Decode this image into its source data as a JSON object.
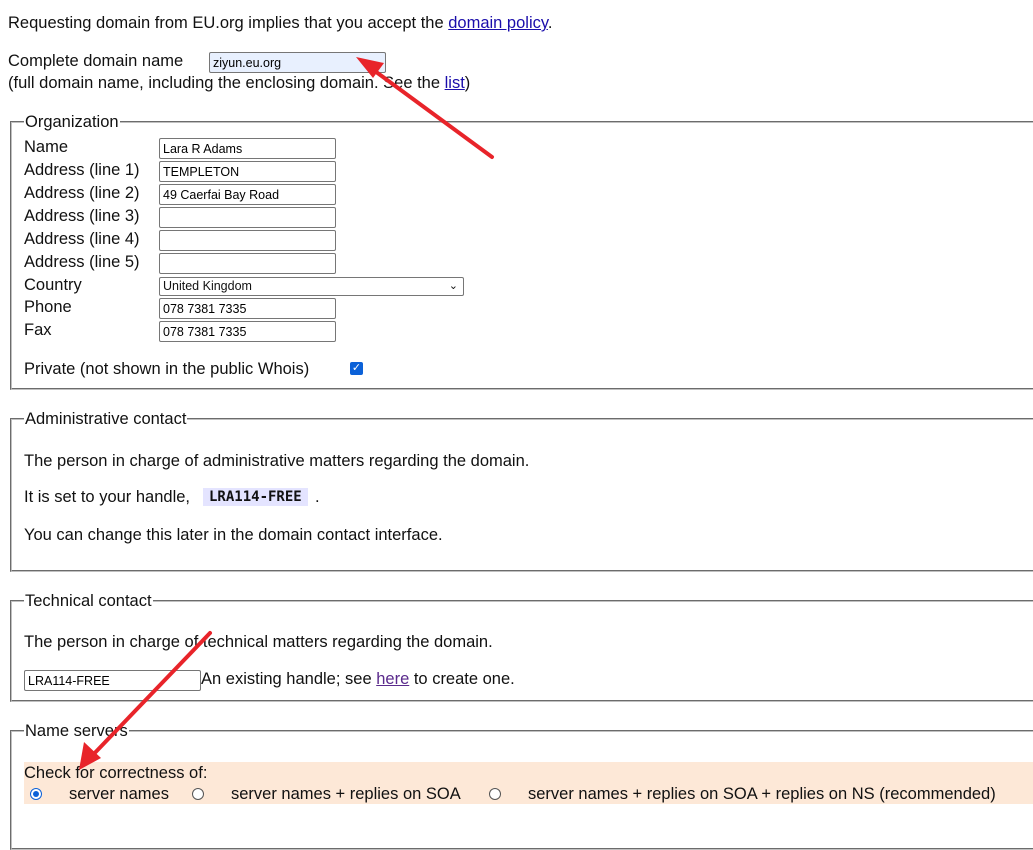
{
  "intro": {
    "text": "Requesting domain from EU.org implies that you accept the",
    "link": "domain policy",
    "suffix": "."
  },
  "domain": {
    "label": "Complete domain name",
    "value": "ziyun.eu.org",
    "help_prefix": "(full domain name, including the enclosing domain. See the",
    "help_link": "list",
    "help_suffix": ")"
  },
  "organization": {
    "legend": "Organization",
    "fields": [
      {
        "label": "Name",
        "value": "Lara R Adams"
      },
      {
        "label": "Address (line 1)",
        "value": "TEMPLETON"
      },
      {
        "label": "Address (line 2)",
        "value": "49 Caerfai Bay Road"
      },
      {
        "label": "Address (line 3)",
        "value": ""
      },
      {
        "label": "Address (line 4)",
        "value": ""
      },
      {
        "label": "Address (line 5)",
        "value": ""
      }
    ],
    "country_label": "Country",
    "country_value": "United Kingdom",
    "phone_label": "Phone",
    "phone_value": "078 7381 7335",
    "fax_label": "Fax",
    "fax_value": "078 7381 7335",
    "private_label": "Private (not shown in the public Whois)",
    "private_checked": true
  },
  "admin": {
    "legend": "Administrative contact",
    "desc": "The person in charge of administrative matters regarding the domain.",
    "handle_prefix": "It is set to your handle,",
    "handle": "LRA114-FREE",
    "handle_suffix": ".",
    "note": "You can change this later in the domain contact interface."
  },
  "technical": {
    "legend": "Technical contact",
    "desc": "The person in charge of technical matters regarding the domain.",
    "handle_value": "LRA114-FREE",
    "hint_prefix": "An existing handle; see",
    "hint_link": "here",
    "hint_suffix": "to create one."
  },
  "nameservers": {
    "legend": "Name servers",
    "check_label": "Check for correctness of:",
    "options": [
      {
        "label": "server names",
        "selected": true
      },
      {
        "label": "server names + replies on SOA",
        "selected": false
      },
      {
        "label": "server names + replies on SOA + replies on NS (recommended)",
        "selected": false
      }
    ]
  },
  "colors": {
    "annotation_arrow": "#e8242a",
    "link": "#1a0dab",
    "check_bar": "#fde8d7",
    "handle_bg": "#e4e4ff"
  }
}
